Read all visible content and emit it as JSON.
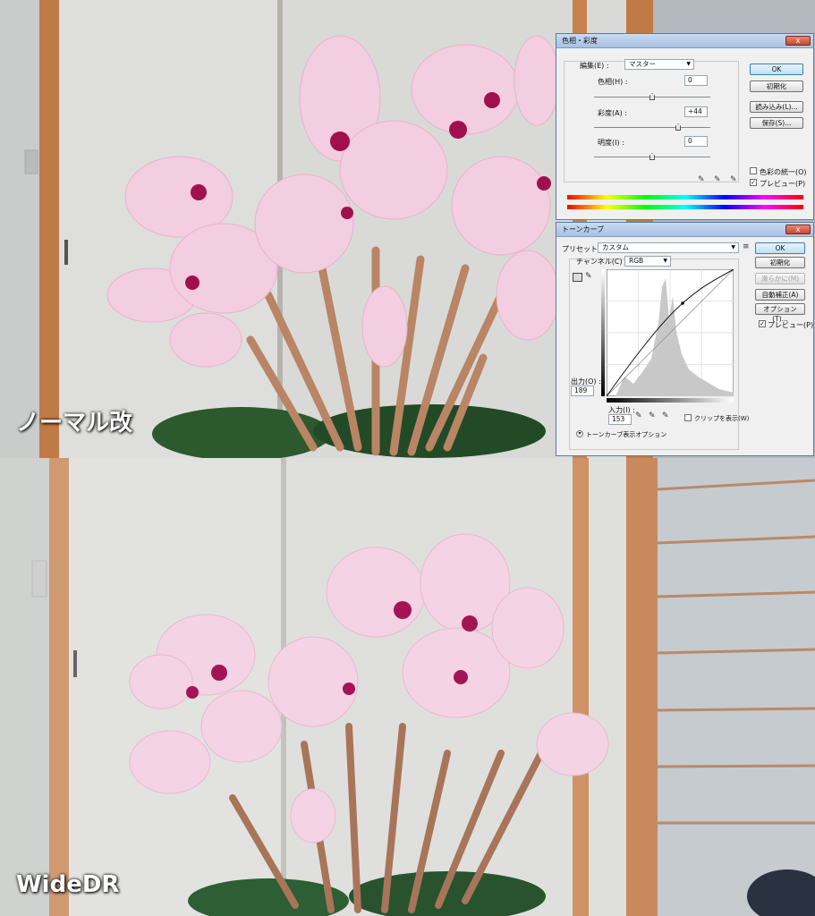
{
  "captions": {
    "top": "ノーマル改",
    "bottom": "WideDR"
  },
  "hue_dialog": {
    "title": "色相・彩度",
    "close_label": "x",
    "edit_label": "編集(E) :",
    "edit_value": "マスター",
    "hue_label": "色相(H) :",
    "hue_value": "0",
    "saturation_label": "彩度(A) :",
    "saturation_value": "+44",
    "lightness_label": "明度(I) :",
    "lightness_value": "0",
    "buttons": {
      "ok": "OK",
      "reset": "初期化",
      "load": "読み込み(L)...",
      "save": "保存(S)..."
    },
    "colorize_label": "色彩の統一(O)",
    "preview_label": "プレビュー(P)"
  },
  "curves_dialog": {
    "title": "トーンカーブ",
    "close_label": "x",
    "preset_label": "プリセット(R) :",
    "preset_value": "カスタム",
    "channel_label": "チャンネル(C) :",
    "channel_value": "RGB",
    "buttons": {
      "ok": "OK",
      "reset": "初期化",
      "smooth": "滑らかに(M)",
      "auto": "自動補正(A)",
      "options": "オプション(T)..."
    },
    "preview_label": "プレビュー(P)",
    "output_label": "出力(O) :",
    "output_value": "189",
    "input_label": "入力(I) :",
    "input_value": "153",
    "clip_label": "クリップを表示(W)",
    "display_options_label": "トーンカーブ表示オプション"
  },
  "colors": {
    "wall": "#dcdcd9",
    "frame": "#c07a45",
    "petal": "#f2c6dc",
    "petal_center": "#a0104c",
    "leaf": "#2c5a2e",
    "stem": "#b98565"
  }
}
